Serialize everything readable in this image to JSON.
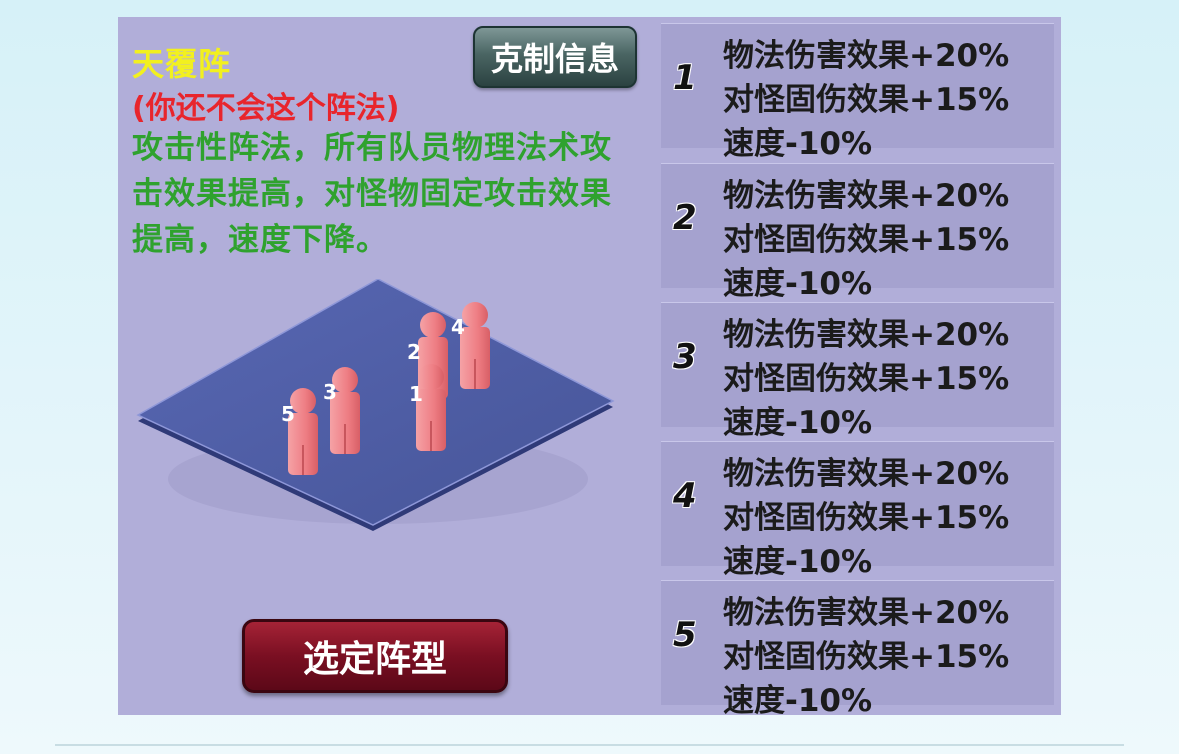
{
  "formation": {
    "name": "天覆阵",
    "status": "(你还不会这个阵法)",
    "description": "攻击性阵法，所有队员物理法术攻击效果提高，对怪物固定攻击效果提高，速度下降。"
  },
  "buttons": {
    "counter_info": "克制信息",
    "select_formation": "选定阵型"
  },
  "board": {
    "slot_labels": [
      "1",
      "2",
      "3",
      "4",
      "5"
    ]
  },
  "positions": [
    {
      "number": "1",
      "effects": [
        "物法伤害效果+20%",
        "对怪固伤效果+15%",
        "速度-10%"
      ]
    },
    {
      "number": "2",
      "effects": [
        "物法伤害效果+20%",
        "对怪固伤效果+15%",
        "速度-10%"
      ]
    },
    {
      "number": "3",
      "effects": [
        "物法伤害效果+20%",
        "对怪固伤效果+15%",
        "速度-10%"
      ]
    },
    {
      "number": "4",
      "effects": [
        "物法伤害效果+20%",
        "对怪固伤效果+15%",
        "速度-10%"
      ]
    },
    {
      "number": "5",
      "effects": [
        "物法伤害效果+20%",
        "对怪固伤效果+15%",
        "速度-10%"
      ]
    }
  ],
  "colors": {
    "panel_bg": "#b1aed9",
    "title": "#f2f01f",
    "warning": "#e8252c",
    "description": "#2fa22e",
    "board": "#4f5ea8",
    "figure": "#f08a8f"
  }
}
